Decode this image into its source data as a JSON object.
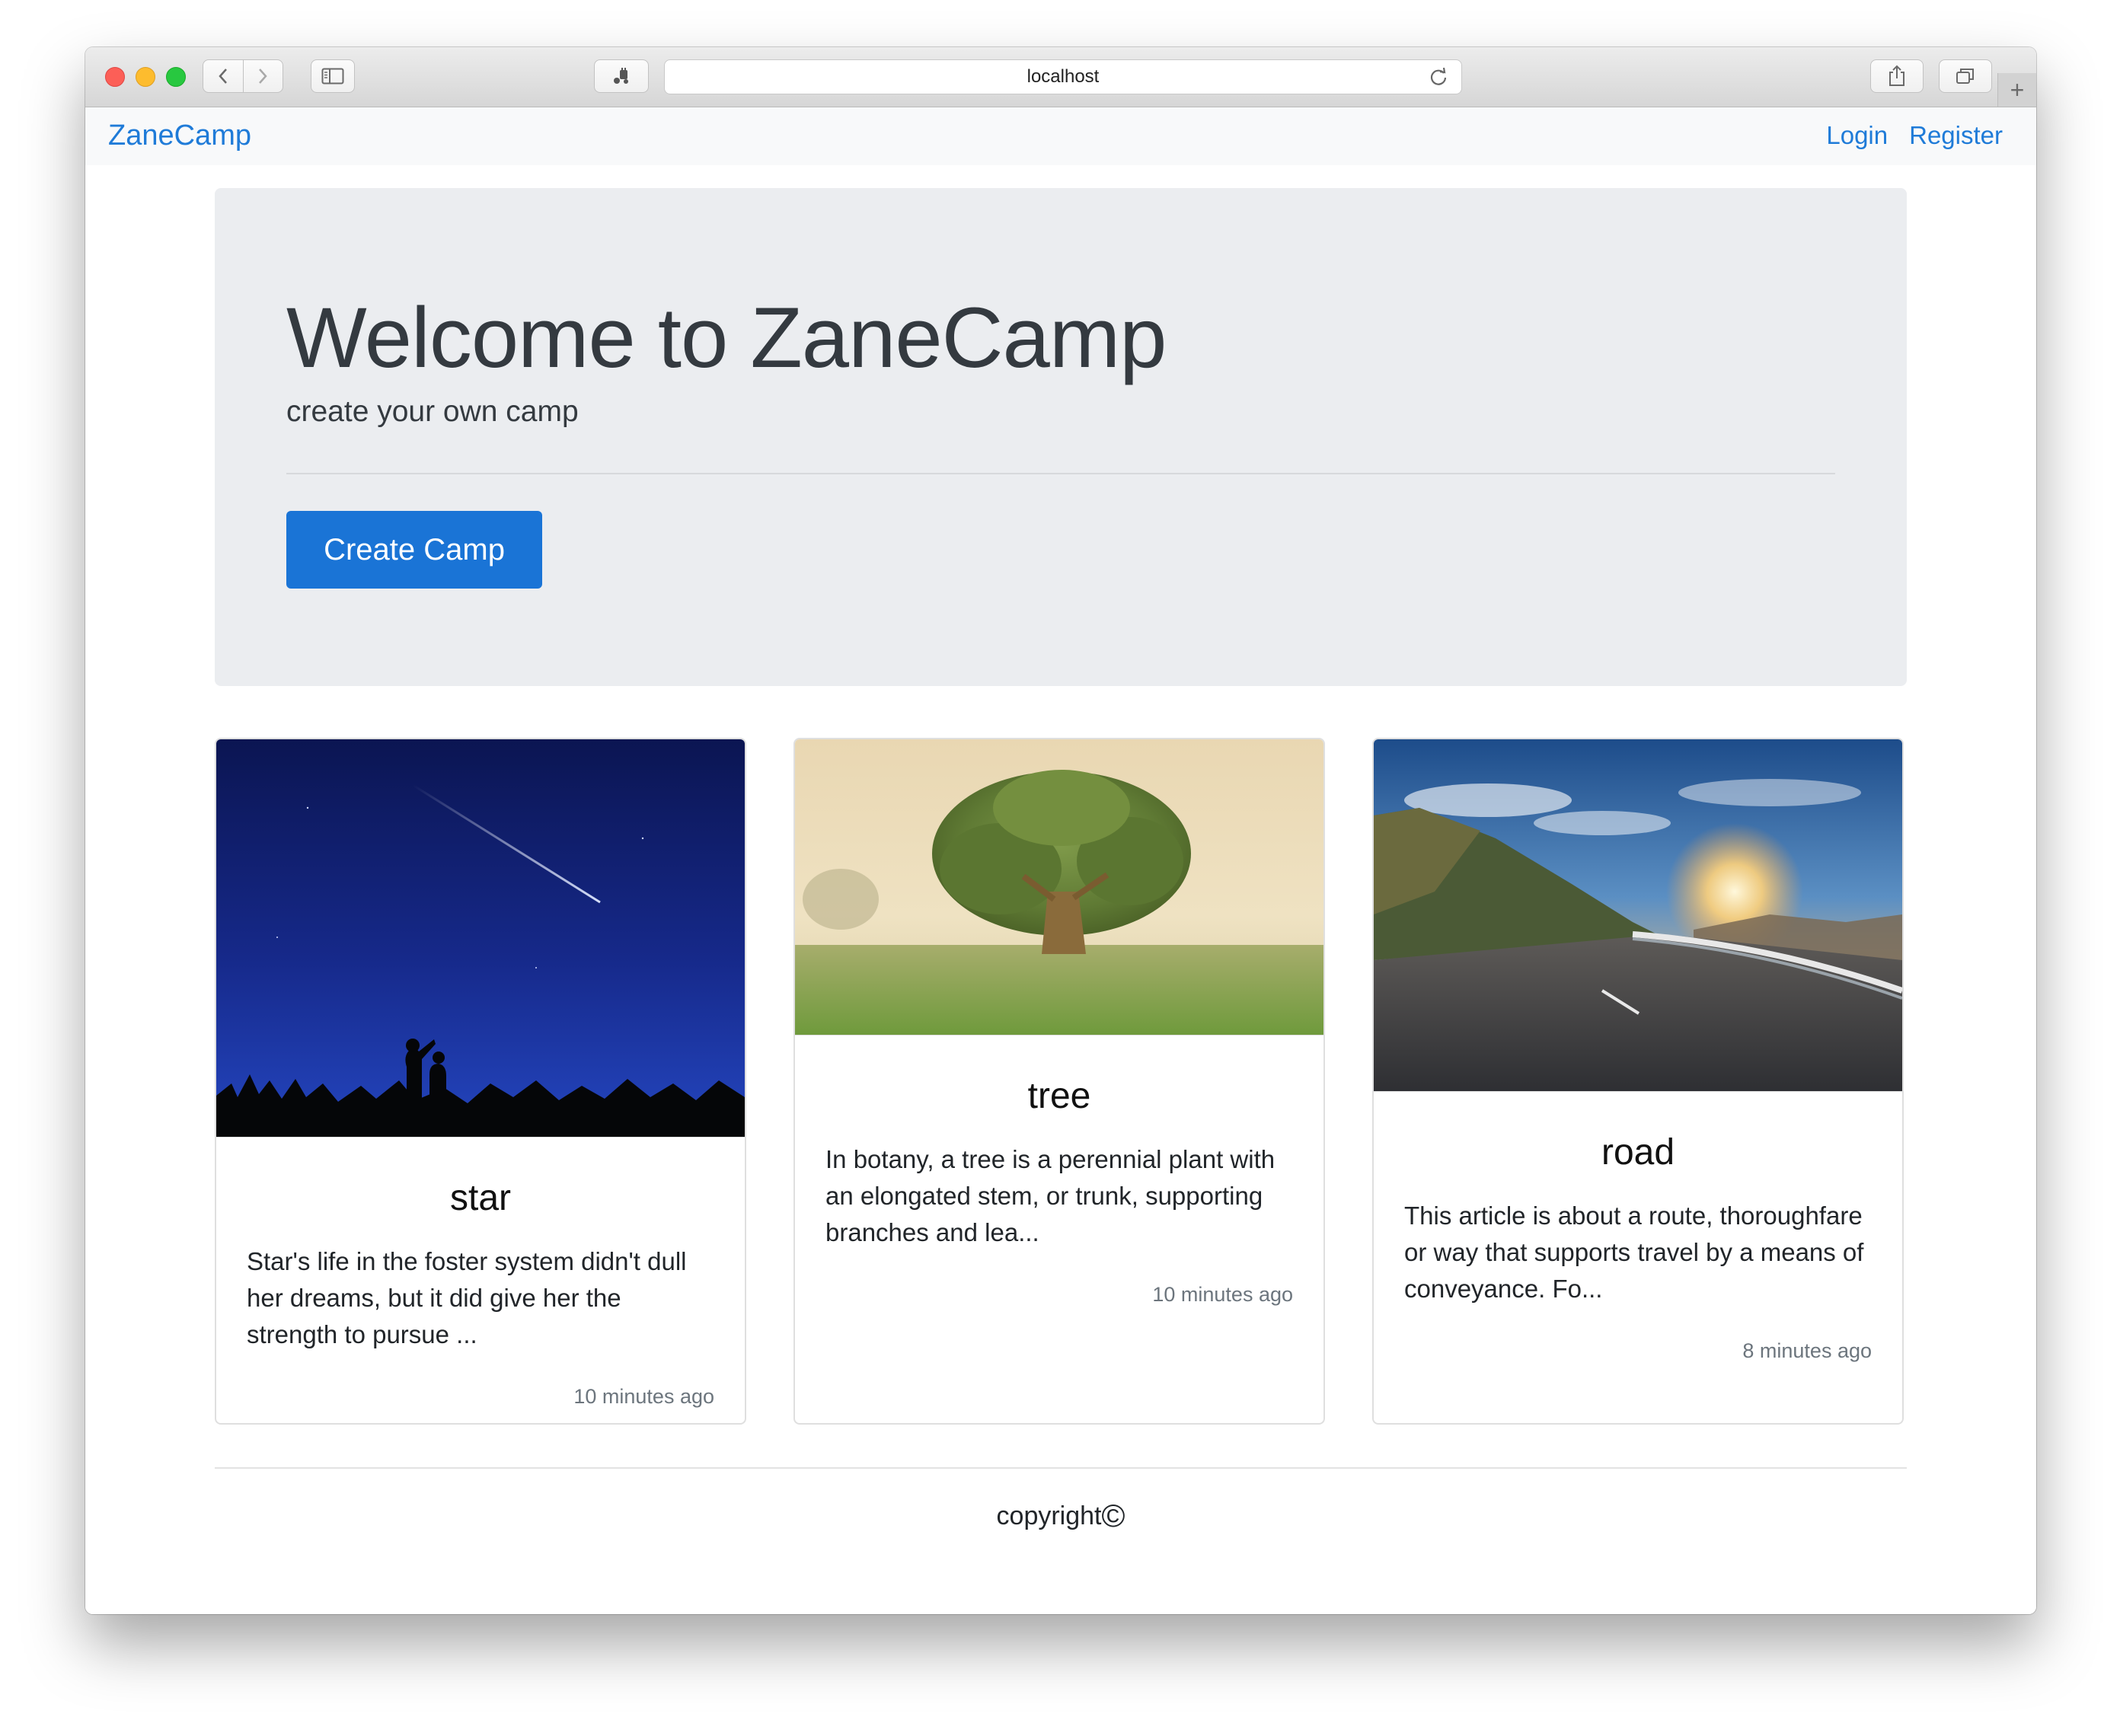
{
  "browser": {
    "url": "localhost"
  },
  "navbar": {
    "brand": "ZaneCamp",
    "login": "Login",
    "register": "Register"
  },
  "jumbotron": {
    "title": "Welcome to ZaneCamp",
    "subtitle": "create your own camp",
    "button": "Create Camp"
  },
  "cards": [
    {
      "title": "star",
      "text": "Star's life in the foster system didn't dull her dreams, but it did give her the strength to pursue ...",
      "time": "10 minutes ago"
    },
    {
      "title": "tree",
      "text": "In botany, a tree is a perennial plant with an elongated stem, or trunk, supporting branches and lea...",
      "time": "10 minutes ago"
    },
    {
      "title": "road",
      "text": "This article is about a route, thoroughfare or way that supports travel by a means of conveyance. Fo...",
      "time": "8 minutes ago"
    }
  ],
  "footer": {
    "text": "copyright",
    "symbol": "©"
  },
  "colors": {
    "link": "#1f7bd8",
    "primary_button": "#1a74d6",
    "jumbotron_bg": "#ebedf0",
    "muted_text": "#6c757d"
  }
}
